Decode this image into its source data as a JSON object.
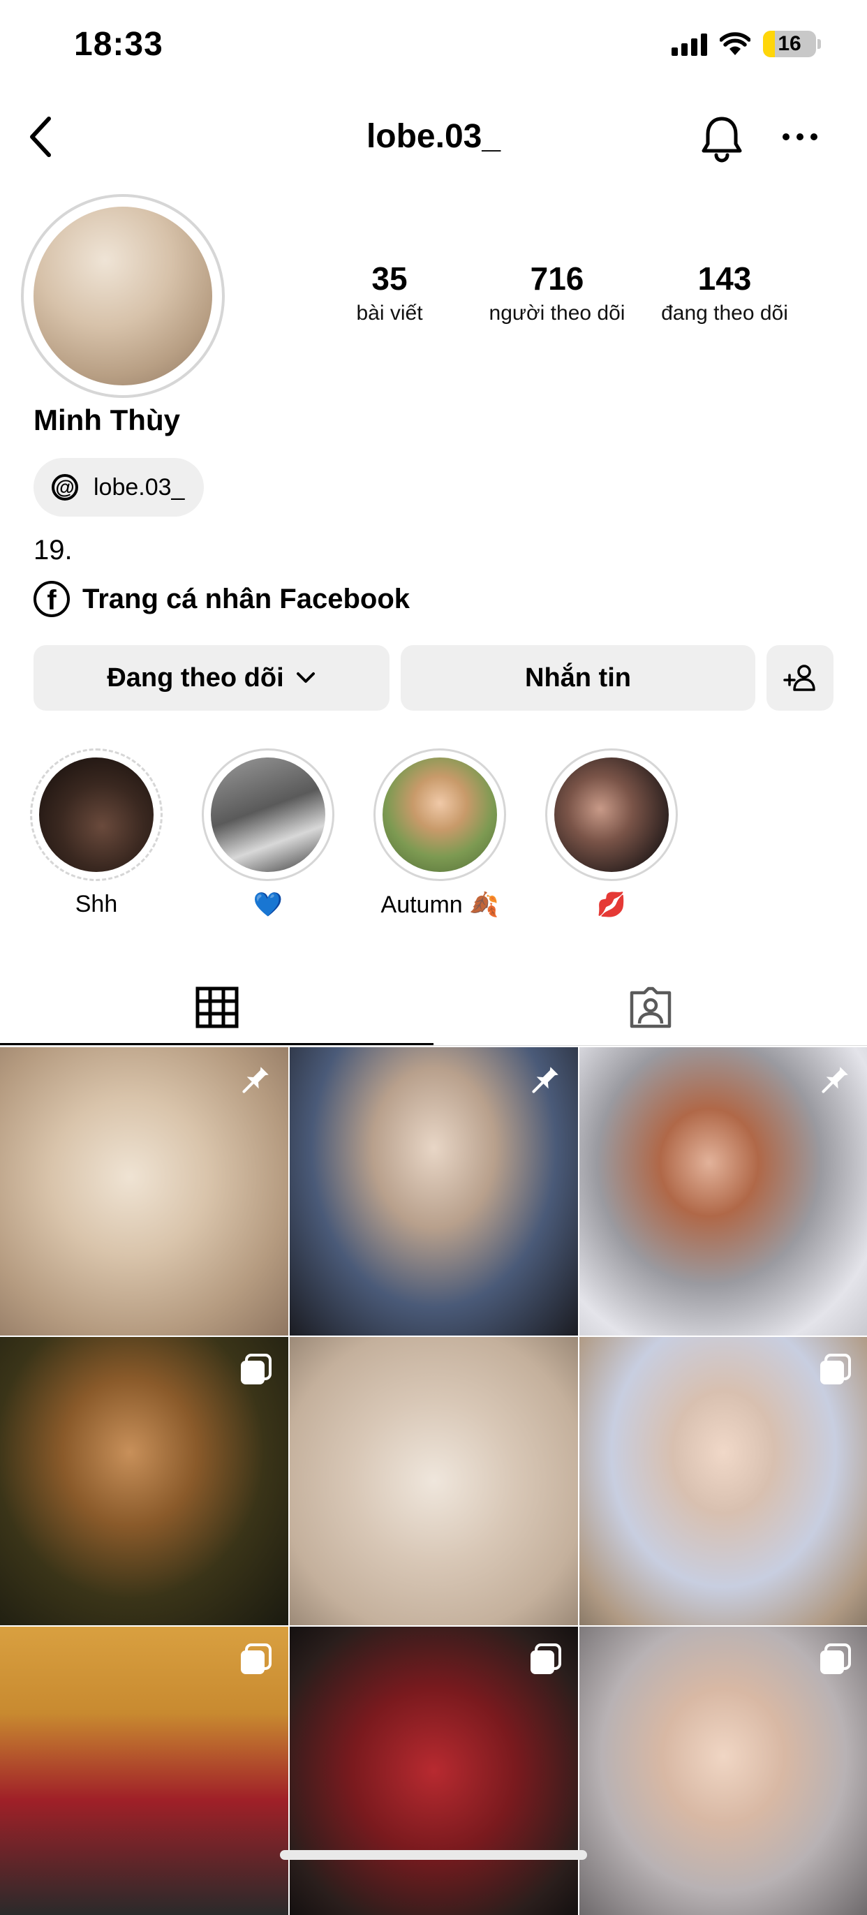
{
  "status": {
    "time": "18:33",
    "battery": "16"
  },
  "nav": {
    "username": "lobe.03_"
  },
  "profile": {
    "display_name": "Minh Thùy",
    "stats": [
      {
        "value": "35",
        "label": "bài viết"
      },
      {
        "value": "716",
        "label": "người theo dõi"
      },
      {
        "value": "143",
        "label": "đang theo dõi"
      }
    ],
    "threads_handle": "lobe.03_",
    "bio": "19.",
    "facebook_link": "Trang cá nhân Facebook"
  },
  "actions": {
    "following": "Đang theo dõi",
    "message": "Nhắn tin"
  },
  "highlights": [
    {
      "label": "Shh"
    },
    {
      "label": "💙"
    },
    {
      "label": "Autumn 🍂"
    },
    {
      "label": "💋"
    }
  ],
  "colors": {
    "accent": "#000000",
    "button_bg": "#efefef",
    "battery_low": "#ffd60a"
  }
}
